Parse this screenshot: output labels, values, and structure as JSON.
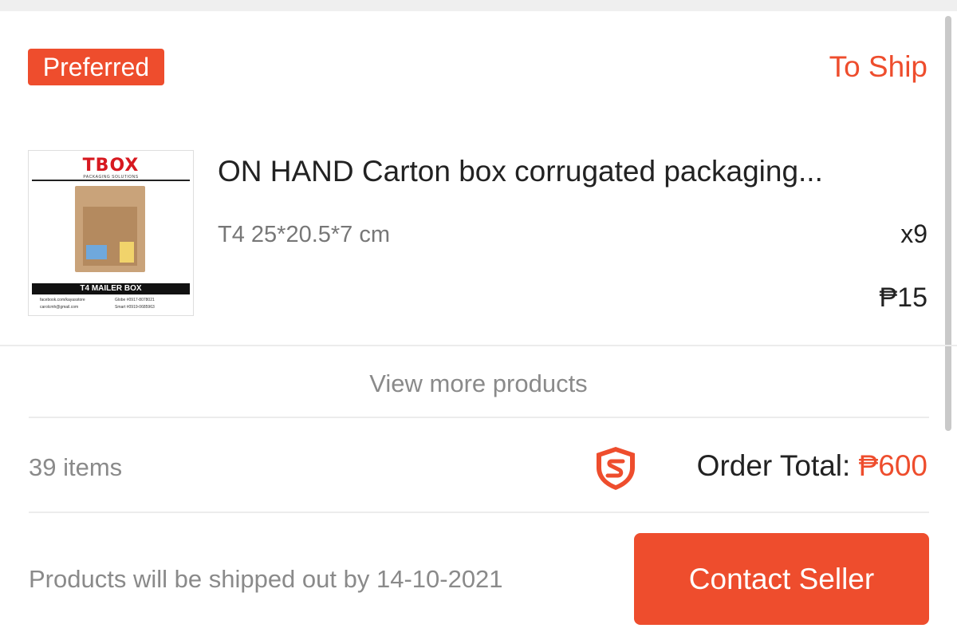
{
  "shop": {
    "badge": "Preferred",
    "status": "To Ship"
  },
  "product": {
    "thumbnail": {
      "brand": "TBOX",
      "brand_sub": "PACKAGING SOLUTIONS",
      "label": "T4 MAILER BOX",
      "contact_1": "facebook.com/kayasstore",
      "contact_2": "Globe #0917-8078021",
      "contact_3": "carolcmh@gmail.com",
      "contact_4": "Smart #0919-0685963"
    },
    "title": "ON HAND Carton box corrugated packaging...",
    "variant": "T4 25*20.5*7 cm",
    "quantity": "x9",
    "price": "₱15"
  },
  "view_more": "View more products",
  "summary": {
    "items_count": "39 items",
    "shield_icon": "shopee-guarantee-shield-icon",
    "order_total_label": "Order Total: ",
    "order_total_amount": "₱600"
  },
  "footer": {
    "ship_note": "Products will be shipped out by 14-10-2021",
    "contact_button": "Contact Seller"
  },
  "colors": {
    "accent": "#ee4d2d",
    "muted_text": "#8a8a8a"
  }
}
